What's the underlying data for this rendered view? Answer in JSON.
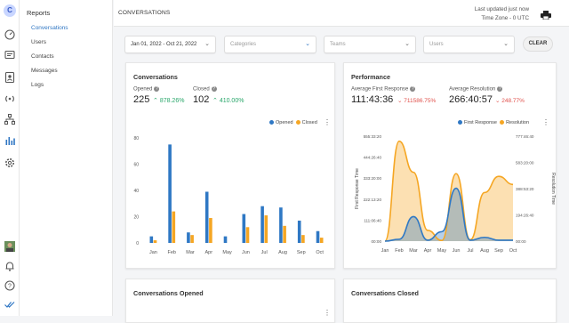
{
  "logo_letter": "C",
  "nav": {
    "title": "Reports",
    "items": [
      {
        "label": "Conversations",
        "active": true
      },
      {
        "label": "Users",
        "active": false
      },
      {
        "label": "Contacts",
        "active": false
      },
      {
        "label": "Messages",
        "active": false
      },
      {
        "label": "Logs",
        "active": false
      }
    ]
  },
  "header": {
    "page_title": "CONVERSATIONS",
    "updated_line1": "Last updated just now",
    "updated_line2": "Time Zone - 0 UTC"
  },
  "filters": {
    "date_range": "Jan 01, 2022 - Oct 21, 2022",
    "categories": "Categories",
    "teams": "Teams",
    "users": "Users",
    "clear_label": "CLEAR"
  },
  "conversations_card": {
    "title": "Conversations",
    "opened_label": "Opened",
    "opened_value": "225",
    "opened_change": "878.26%",
    "closed_label": "Closed",
    "closed_value": "102",
    "closed_change": "410.00%"
  },
  "performance_card": {
    "title": "Performance",
    "afr_label": "Average First Response",
    "afr_value": "111:43:36",
    "afr_change": "711586.75%",
    "ar_label": "Average Resolution",
    "ar_value": "266:40:57",
    "ar_change": "248.77%"
  },
  "opened_card_title": "Conversations Opened",
  "closed_card_title": "Conversations Closed",
  "colors": {
    "blue": "#2f78c4",
    "orange": "#f5a623",
    "green": "#2aa76b",
    "red": "#e0514c"
  },
  "chart_data": [
    {
      "type": "bar",
      "categories": [
        "Jan",
        "Feb",
        "Mar",
        "Apr",
        "May",
        "Jun",
        "Jul",
        "Aug",
        "Sep",
        "Oct"
      ],
      "series": [
        {
          "name": "Opened",
          "values": [
            5,
            75,
            8,
            39,
            5,
            22,
            28,
            27,
            17,
            9
          ]
        },
        {
          "name": "Closed",
          "values": [
            2,
            24,
            6,
            19,
            0,
            12,
            21,
            13,
            6,
            4
          ]
        }
      ],
      "ylim": [
        0,
        80
      ],
      "yticks": [
        0,
        20,
        40,
        60,
        80
      ],
      "legend": "top-right"
    },
    {
      "type": "area",
      "categories": [
        "Jan",
        "Feb",
        "Mar",
        "Apr",
        "May",
        "Jun",
        "Jul",
        "Aug",
        "Sep",
        "Oct"
      ],
      "series": [
        {
          "name": "First Response",
          "axis": "left",
          "unit": "hours",
          "values": [
            0,
            10,
            130,
            5,
            50,
            280,
            5,
            20,
            5,
            5
          ]
        },
        {
          "name": "Resolution",
          "axis": "right",
          "unit": "hours",
          "values": [
            0,
            740,
            510,
            80,
            5,
            500,
            10,
            360,
            480,
            420
          ]
        }
      ],
      "ylabel_left": "First Response Time",
      "ylabel_right": "Resolution Time",
      "yticks_left": [
        "00:00",
        "111:06:40",
        "222:13:20",
        "333:20:00",
        "444:26:40",
        "555:33:20"
      ],
      "yticks_right": [
        "00:00",
        "194:26:40",
        "388:53:20",
        "583:20:00",
        "777:46:40"
      ],
      "legend": "top-right"
    }
  ]
}
